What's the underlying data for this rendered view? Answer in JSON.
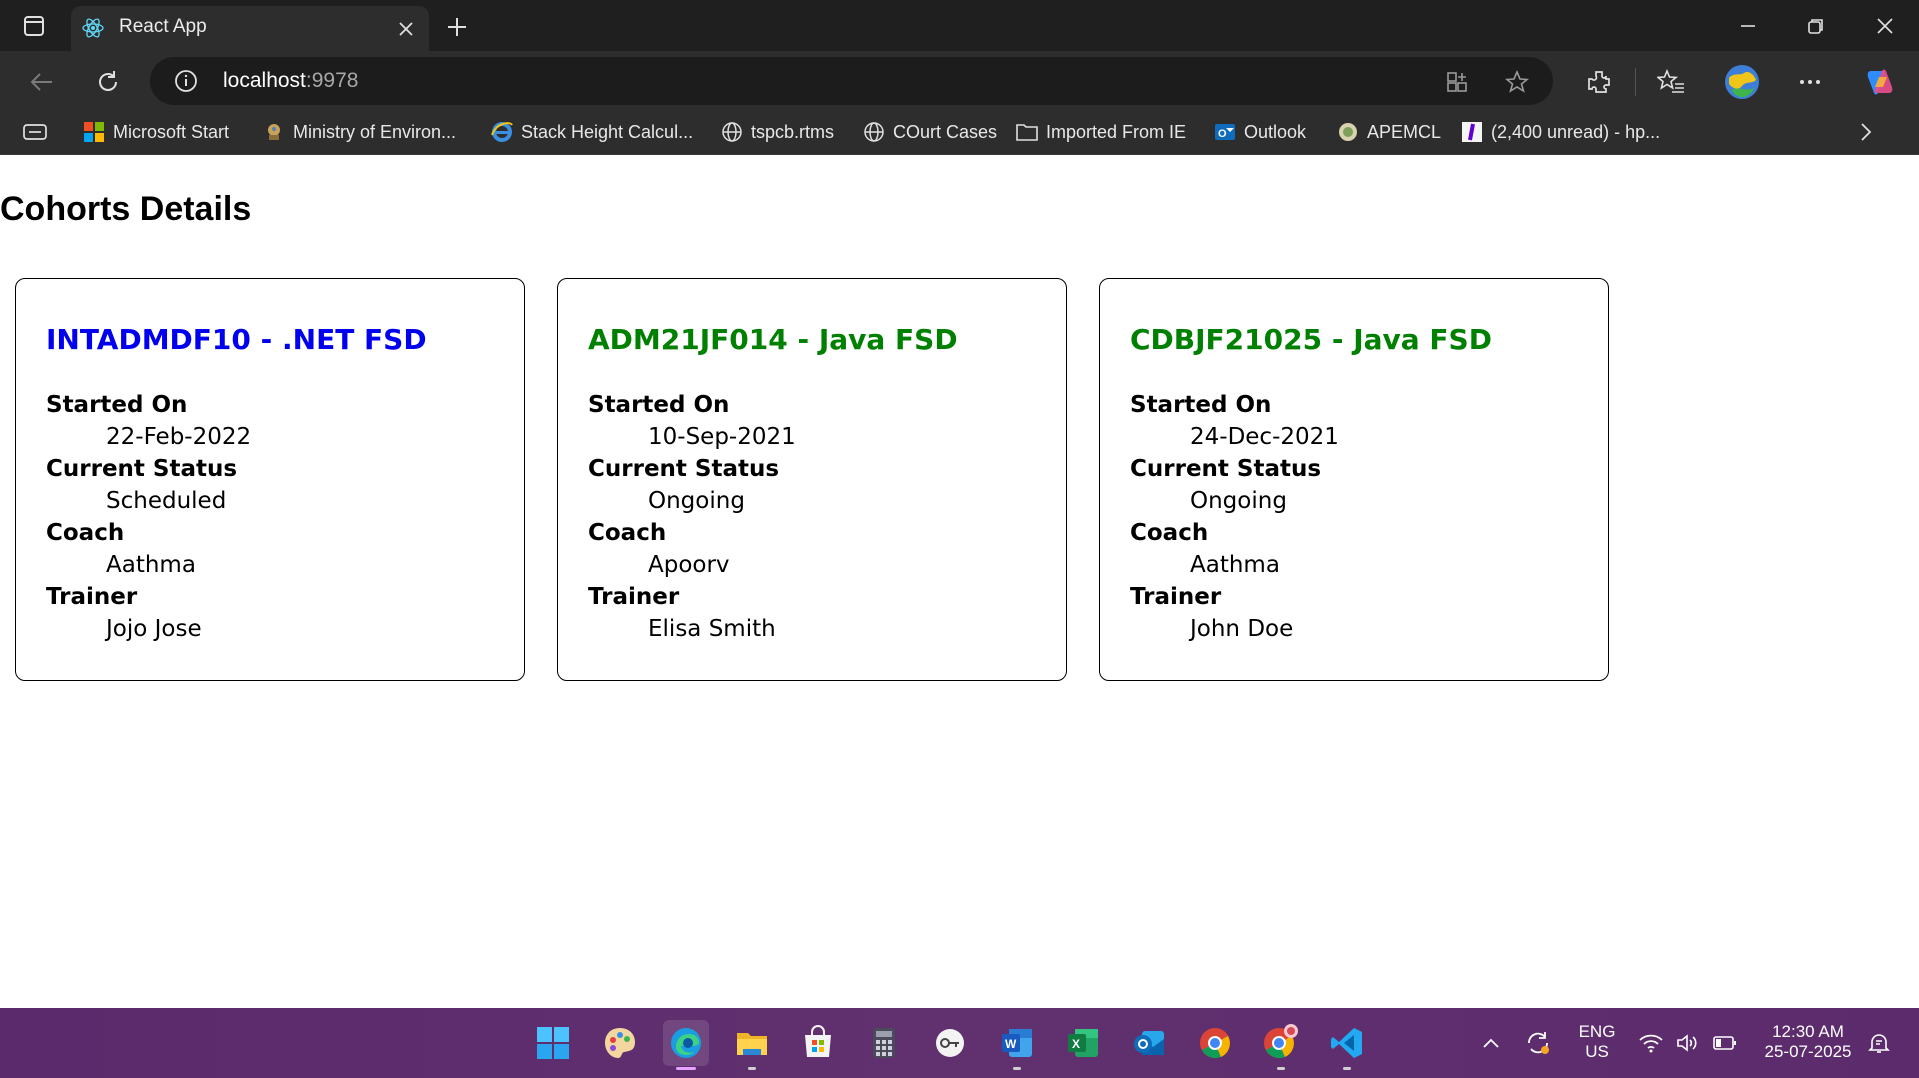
{
  "browser": {
    "tab_title": "React App",
    "address_host": "localhost",
    "address_port": ":9978",
    "bookmarks": [
      {
        "label": "Microsoft Start",
        "icon": "microsoft-logo-icon"
      },
      {
        "label": "Ministry of Environ...",
        "icon": "emblem-icon"
      },
      {
        "label": "Stack Height Calcul...",
        "icon": "ie-logo-icon"
      },
      {
        "label": "tspcb.rtms",
        "icon": "globe-icon"
      },
      {
        "label": "COurt Cases",
        "icon": "globe-icon"
      },
      {
        "label": "Imported From IE",
        "icon": "folder-icon"
      },
      {
        "label": "Outlook",
        "icon": "outlook-icon"
      },
      {
        "label": "APEMCL",
        "icon": "seal-icon"
      },
      {
        "label": "(2,400 unread) - hp...",
        "icon": "yahoo-mail-icon"
      }
    ]
  },
  "page": {
    "title": "Cohorts Details",
    "cohorts": [
      {
        "name": "INTADMDF10 - .NET FSD",
        "color": "#0000ee",
        "started_label": "Started On",
        "started": "22-Feb-2022",
        "status_label": "Current Status",
        "status": "Scheduled",
        "coach_label": "Coach",
        "coach": "Aathma",
        "trainer_label": "Trainer",
        "trainer": "Jojo Jose"
      },
      {
        "name": "ADM21JF014 - Java FSD",
        "color": "#008000",
        "started_label": "Started On",
        "started": "10-Sep-2021",
        "status_label": "Current Status",
        "status": "Ongoing",
        "coach_label": "Coach",
        "coach": "Apoorv",
        "trainer_label": "Trainer",
        "trainer": "Elisa Smith"
      },
      {
        "name": "CDBJF21025 - Java FSD",
        "color": "#008000",
        "started_label": "Started On",
        "started": "24-Dec-2021",
        "status_label": "Current Status",
        "status": "Ongoing",
        "coach_label": "Coach",
        "coach": "Aathma",
        "trainer_label": "Trainer",
        "trainer": "John Doe"
      }
    ]
  },
  "taskbar": {
    "lang_line1": "ENG",
    "lang_line2": "US",
    "time": "12:30 AM",
    "date": "25-07-2025"
  }
}
